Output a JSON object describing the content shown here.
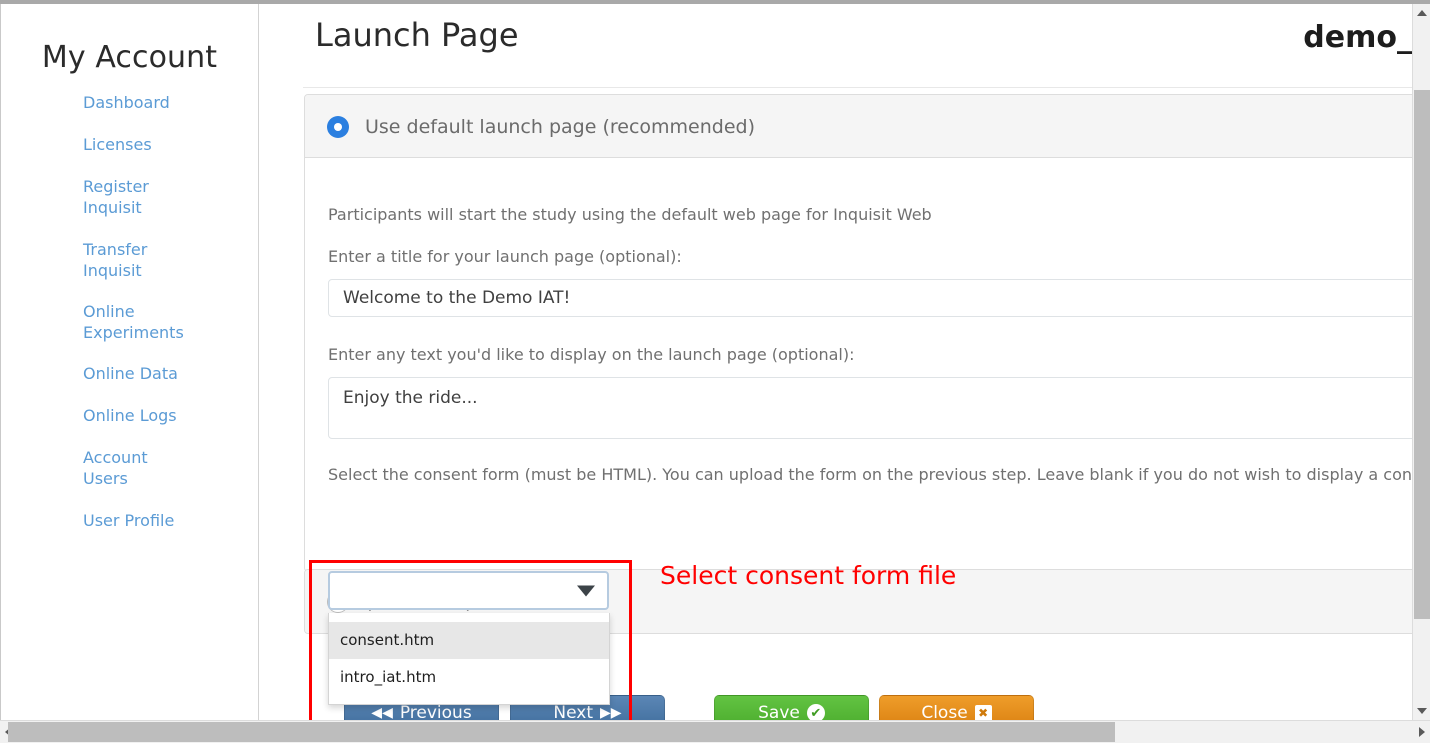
{
  "sidebar": {
    "title": "My Account",
    "items": [
      {
        "label": "Dashboard"
      },
      {
        "label": "Licenses"
      },
      {
        "label": "Register Inquisit"
      },
      {
        "label": "Transfer Inquisit"
      },
      {
        "label": "Online Experiments"
      },
      {
        "label": "Online Data"
      },
      {
        "label": "Online Logs"
      },
      {
        "label": "Account Users"
      },
      {
        "label": "User Profile"
      }
    ]
  },
  "header": {
    "title": "Launch Page",
    "account_name": "demo_"
  },
  "panels": [
    {
      "radio_label": "Use default launch page (recommended)",
      "radio_checked": true,
      "description": "Participants will start the study using the default web page for Inquisit Web",
      "title_label": "Enter a title for your launch page (optional):",
      "title_value": "Welcome to the Demo IAT!",
      "body_label": "Enter any text you'd like to display on the launch page (optional):",
      "body_value": "Enjoy the ride...",
      "consent_label": "Select the consent form (must be HTML). You can upload the form on the previous step. Leave blank if you do not wish to display a consent f"
    },
    {
      "radio_label": "(advanced)",
      "radio_checked": false
    }
  ],
  "consent_select": {
    "value": "",
    "expanded": true,
    "options": [
      {
        "label": "consent.htm",
        "highlighted": true
      },
      {
        "label": "intro_iat.htm",
        "highlighted": false
      }
    ]
  },
  "annotation": {
    "text": "Select consent form file",
    "color": "#ff0000"
  },
  "buttons": {
    "previous": {
      "label": "Previous",
      "icon": "rewind-icon",
      "glyph": "◀◀",
      "color": "#3f6d9c"
    },
    "next": {
      "label": "Next",
      "icon": "fast-forward-icon",
      "glyph": "▶▶",
      "color": "#3f6d9c"
    },
    "save": {
      "label": "Save",
      "icon": "check-circle-icon",
      "glyph": "✔",
      "color": "#4aab2c"
    },
    "close": {
      "label": "Close",
      "icon": "close-box-icon",
      "glyph": "✖",
      "color": "#d97f10"
    }
  },
  "scrollbars": {
    "vertical_position": "near-top",
    "horizontal_position": "left"
  },
  "colors": {
    "link": "#5b9bd5",
    "radio_checked": "#2b7fe0",
    "annotation": "#ff0000",
    "panel_head_bg": "#f5f5f5",
    "panel_border": "#dddddd"
  }
}
